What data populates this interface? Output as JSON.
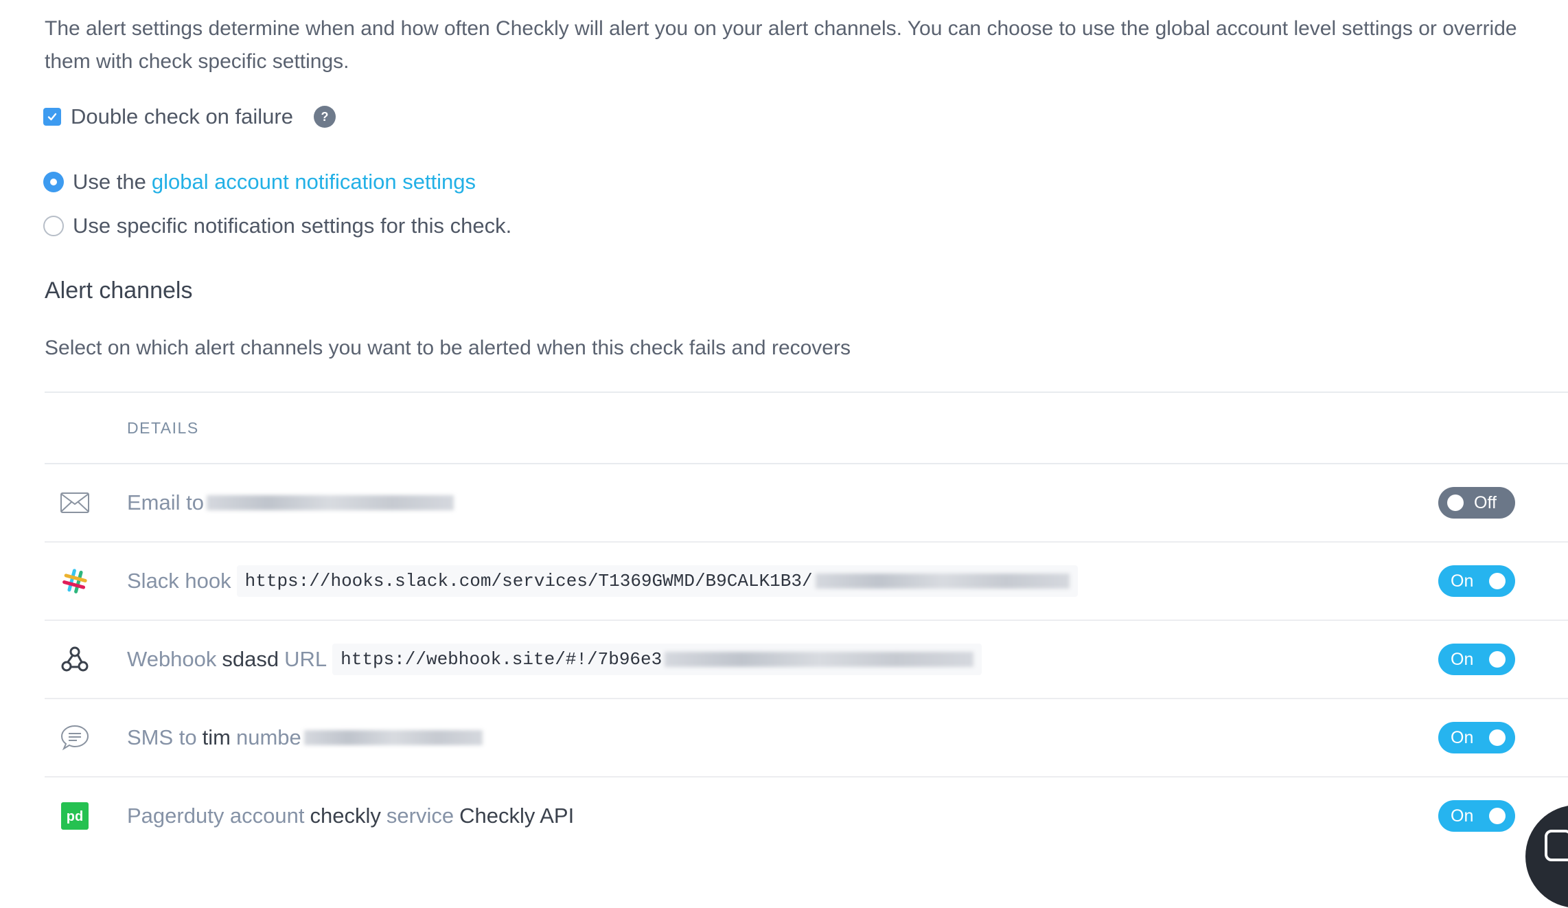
{
  "intro": {
    "line1": "The alert settings determine when and how often Checkly will alert you on your alert channels. You can choose to use the global account level settings or override",
    "line2": "them with check specific settings."
  },
  "double_check": {
    "label": "Double check on failure",
    "checked": true,
    "help": "?"
  },
  "notification_mode": {
    "global_prefix": "Use the",
    "global_link": "global account notification settings",
    "specific_label": "Use specific notification settings for this check.",
    "selected": "global"
  },
  "alert_channels": {
    "title": "Alert channels",
    "subtitle": "Select on which alert channels you want to be alerted when this check fails and recovers",
    "column_header": "DETAILS",
    "rows": [
      {
        "icon": "envelope-icon",
        "label": "Email to",
        "state": "Off"
      },
      {
        "icon": "slack-icon",
        "label": "Slack hook",
        "url": "https://hooks.slack.com/services/T1369GWMD/B9CALK1B3/",
        "state": "On"
      },
      {
        "icon": "webhook-icon",
        "label": "Webhook",
        "name": "sdasd",
        "url_label": "URL",
        "url": "https://webhook.site/#!/7b96e3",
        "state": "On"
      },
      {
        "icon": "chat-bubble-icon",
        "label": "SMS to",
        "name": "tim",
        "number_label": "numbe",
        "state": "On"
      },
      {
        "icon": "pagerduty-icon",
        "label": "Pagerduty account",
        "account": "checkly",
        "service_label": "service",
        "service": "Checkly API",
        "state": "On"
      }
    ]
  },
  "colors": {
    "accent": "#3d9bf0",
    "toggle_on": "#26b4ef",
    "toggle_off": "#6b7788",
    "link": "#22b0e6",
    "pagerduty": "#25c151"
  }
}
